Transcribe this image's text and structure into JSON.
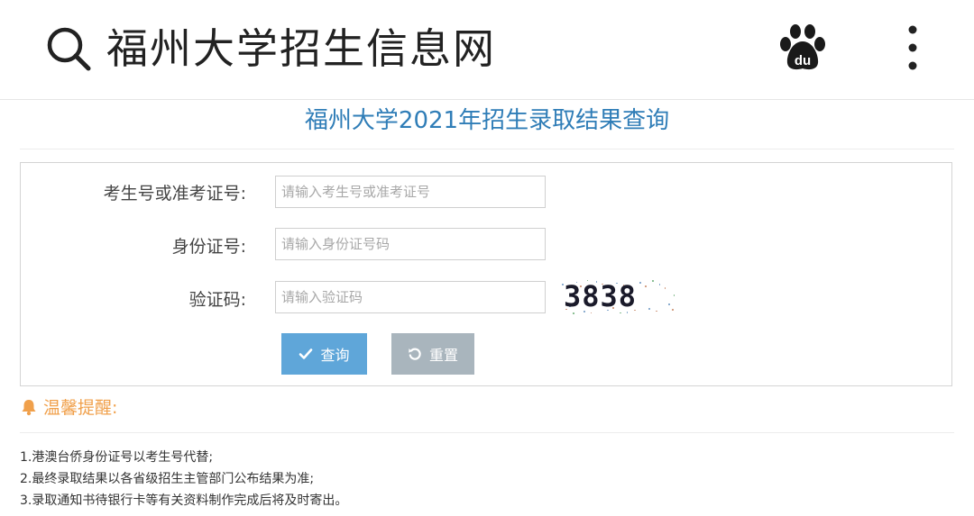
{
  "header": {
    "search_icon": "search-icon",
    "title": "福州大学招生信息网",
    "baidu_icon": "baidu-paw-icon",
    "baidu_text": "du",
    "more_icon": "more-vertical-icon"
  },
  "page": {
    "heading": "福州大学2021年招生录取结果查询"
  },
  "form": {
    "exam_no_label": "考生号或准考证号:",
    "exam_no_placeholder": "请输入考生号或准考证号",
    "exam_no_value": "",
    "id_label": "身份证号:",
    "id_placeholder": "请输入身份证号码",
    "id_value": "",
    "captcha_label": "验证码:",
    "captcha_placeholder": "请输入验证码",
    "captcha_value": "",
    "captcha_text": "3838",
    "query_button": "查询",
    "reset_button": "重置"
  },
  "tips": {
    "title": "温馨提醒:",
    "items": [
      "1.港澳台侨身份证号以考生号代替;",
      "2.最终录取结果以各省级招生主管部门公布结果为准;",
      "3.录取通知书待银行卡等有关资料制作完成后将及时寄出。"
    ]
  },
  "colors": {
    "heading": "#2f7db7",
    "query_button": "#5fa6d9",
    "reset_button": "#a9b5bd",
    "tips_accent": "#f0a04b"
  }
}
